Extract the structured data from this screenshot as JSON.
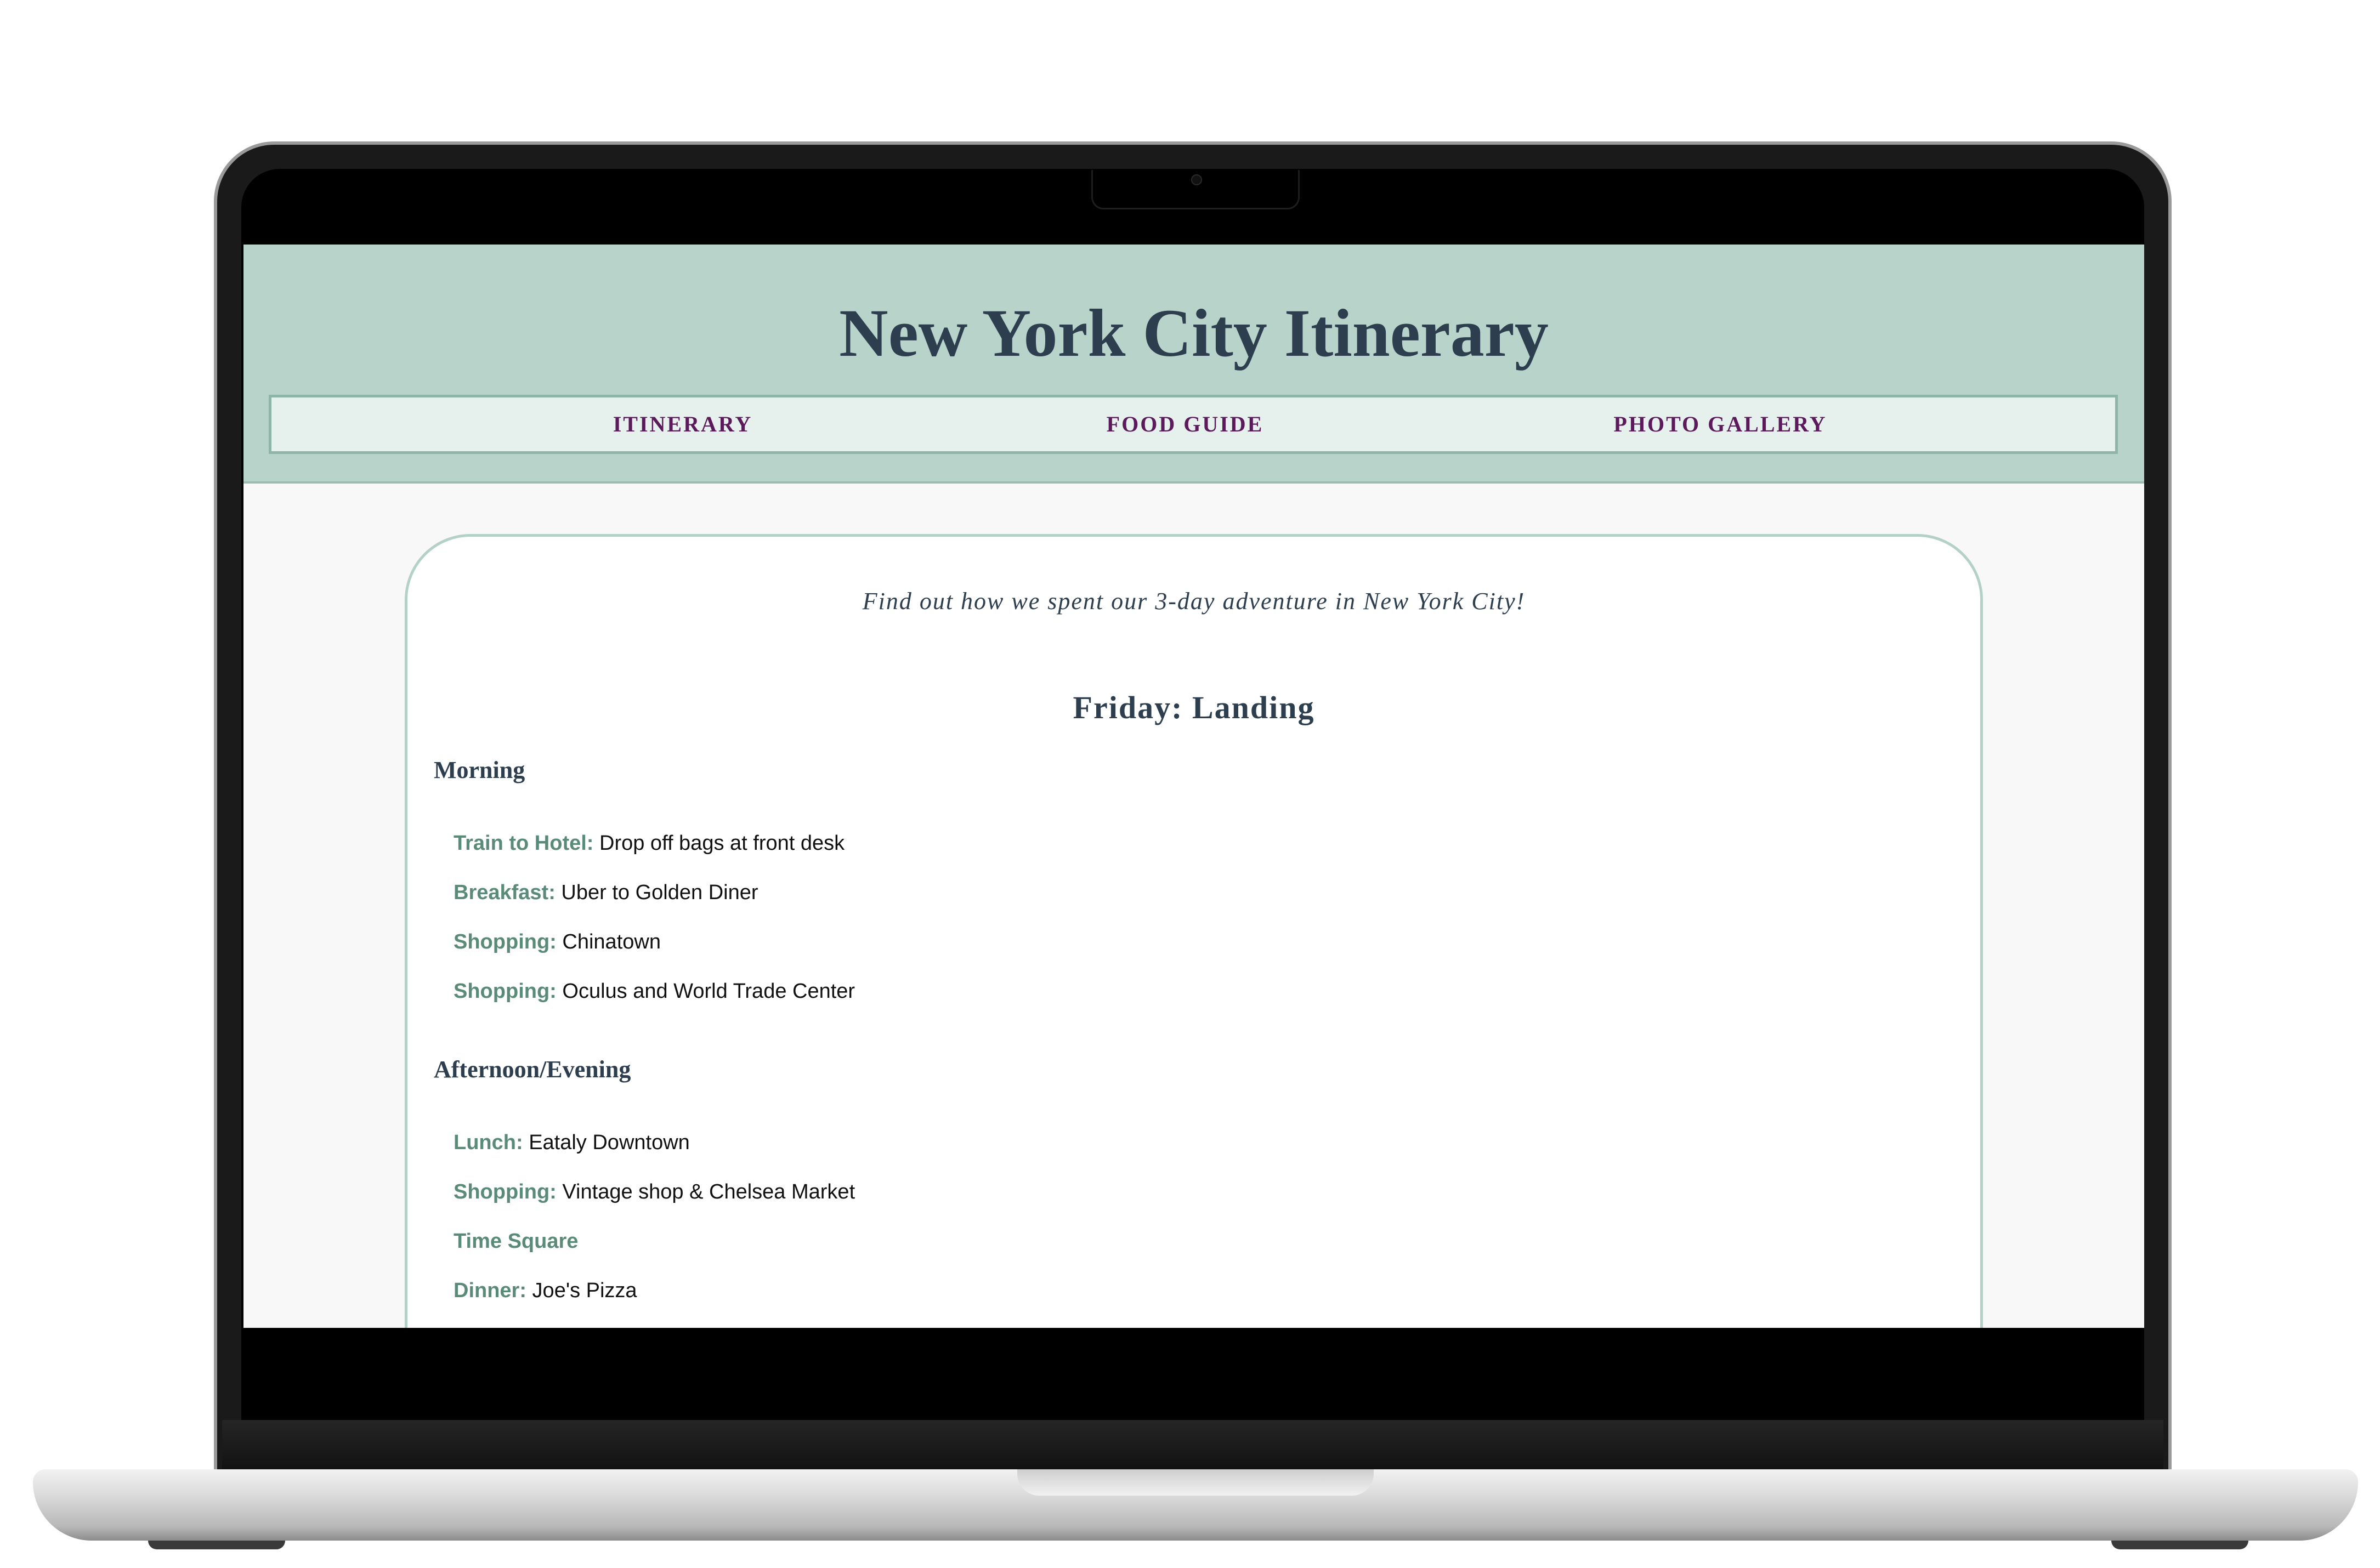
{
  "site": {
    "title": "New York City Itinerary"
  },
  "nav": {
    "items": [
      {
        "label": "ITINERARY"
      },
      {
        "label": "FOOD GUIDE"
      },
      {
        "label": "PHOTO GALLERY"
      }
    ]
  },
  "main": {
    "intro": "Find out how we spent our 3-day adventure in New York City!",
    "day_title": "Friday: Landing",
    "sections": [
      {
        "title": "Morning",
        "items": [
          {
            "label": "Train to Hotel:",
            "text": " Drop off bags at front desk"
          },
          {
            "label": "Breakfast:",
            "text": " Uber to Golden Diner"
          },
          {
            "label": "Shopping:",
            "text": " Chinatown"
          },
          {
            "label": "Shopping:",
            "text": " Oculus and World Trade Center"
          }
        ]
      },
      {
        "title": "Afternoon/Evening",
        "items": [
          {
            "label": "Lunch:",
            "text": " Eataly Downtown"
          },
          {
            "label": "Shopping:",
            "text": " Vintage shop & Chelsea Market"
          },
          {
            "label": "Time Square",
            "text": ""
          },
          {
            "label": "Dinner:",
            "text": " Joe's Pizza"
          }
        ]
      }
    ]
  },
  "colors": {
    "header_bg": "#b8d4ca",
    "nav_bg": "#e6f0ec",
    "nav_text": "#5c1a5c",
    "heading_text": "#2d3e4f",
    "item_label": "#5a8a78",
    "card_border": "#b3d1c7"
  }
}
